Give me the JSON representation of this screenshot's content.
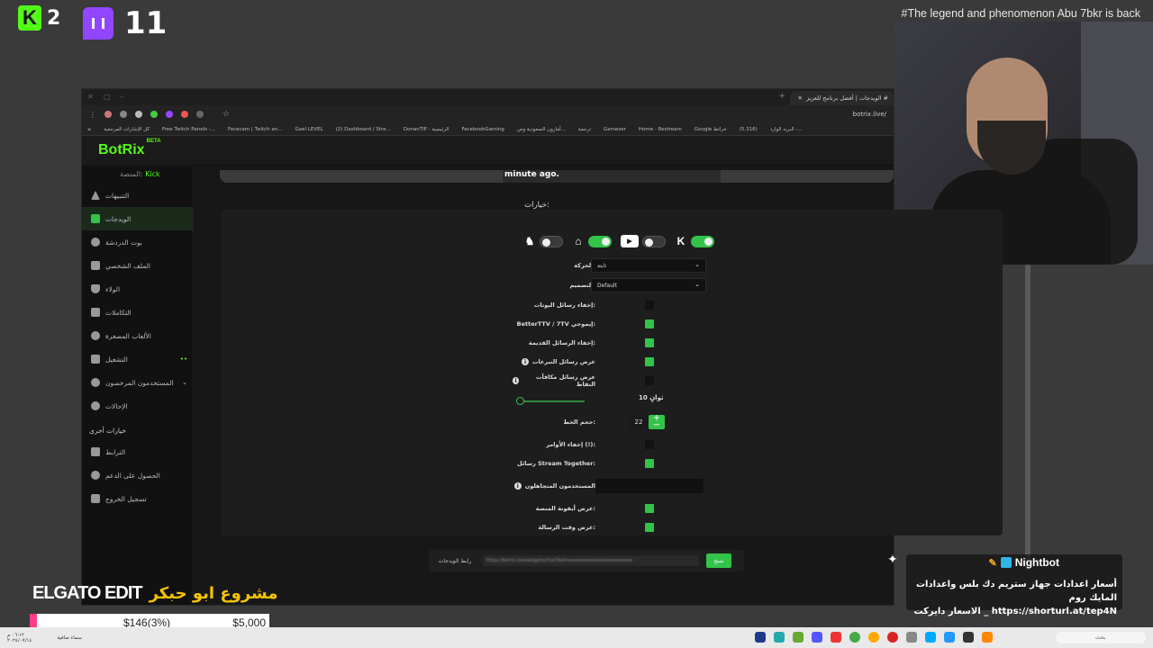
{
  "overlay": {
    "kick_count": "2",
    "twitch_count": "11",
    "kick_icon": "K",
    "marquee": "#The legend and phenomenon Abu 7bkr is back"
  },
  "browser": {
    "tab_title": "الويدجات | أفضل برنامج للعزيز #",
    "url": "botrix.live/",
    "bookmarks": [
      "كل الإشارات المرجعية",
      "Free Twitch Panels -...",
      "Facecam | Twitch an...",
      "Gael LEVEL",
      "(2) Dashboard / Stre...",
      "DonanTIP - الرئيسية",
      "FacebookGaming",
      "أمازون السعودية وص...",
      "ترجمة",
      "Gamezer",
      "Home - Restream",
      "Google خرائط",
      "(5,316)",
      "البريد الوارد -..."
    ]
  },
  "app": {
    "logo": "BotRix",
    "beta": "BETA",
    "platform_label": "المنصة:",
    "platform_value": "Kick",
    "nav": [
      {
        "label": "التنبيهات",
        "icon": "warning-icon"
      },
      {
        "label": "الويدجات",
        "icon": "widgets-icon"
      },
      {
        "label": "بوت الدردشة",
        "icon": "bot-icon"
      },
      {
        "label": "الملف الشخصي",
        "icon": "profile-icon"
      },
      {
        "label": "الولاء",
        "icon": "trophy-icon"
      },
      {
        "label": "التكاملات",
        "icon": "integrations-icon"
      },
      {
        "label": "الألعاب المصغرة",
        "icon": "gamepad-icon"
      },
      {
        "label": "التشغيل",
        "icon": "music-icon",
        "badge": "••"
      },
      {
        "label": "المستخدمون المرخصون",
        "icon": "users-icon",
        "chevron": "⌄"
      },
      {
        "label": "الإحالات",
        "icon": "referrals-icon"
      }
    ],
    "other_section": "خيارات أخرى",
    "other_nav": [
      {
        "label": "الترابط",
        "icon": "link-icon"
      },
      {
        "label": "الحصول على الدعم",
        "icon": "help-icon"
      },
      {
        "label": "تسجيل الخروج",
        "icon": "logout-icon"
      }
    ]
  },
  "content": {
    "toast_text": "minute ago.",
    "options_title": "خيارات:",
    "platform_toggles": [
      {
        "icon": "kick-icon",
        "glyph": "K",
        "on": true
      },
      {
        "icon": "youtube-icon",
        "glyph": "▶",
        "on": false
      },
      {
        "icon": "twitch-icon",
        "glyph": "⌂",
        "on": true
      },
      {
        "icon": "trovo-icon",
        "glyph": "♞",
        "on": false
      }
    ],
    "motion_label": "الحركة:",
    "motion_value": "ثابتة",
    "design_label": "التصميم:",
    "design_value": "Default",
    "options": [
      {
        "label": "إخفاء رسائل البوتات:",
        "checked": false
      },
      {
        "label": "BetterTTV / 7TV إيموجي:",
        "checked": true
      },
      {
        "label": "إخفاء الرسائل القديمة:",
        "checked": true
      },
      {
        "label": "عرض رسائل التبرعات",
        "checked": true,
        "info": true
      },
      {
        "label": "عرض رسائل مكافآت النقاط",
        "checked": false,
        "info": true
      }
    ],
    "duration_value": "10 ثوانٍ",
    "font_size_label": "حجم الخط:",
    "font_size_value": "22",
    "stepper_plus": "+",
    "stepper_minus": "−",
    "options2": [
      {
        "label": "إخفاء الأوامر (!):",
        "checked": false
      },
      {
        "label": "رسائل Stream Together:",
        "checked": true
      }
    ],
    "ignored_users_label": "المستخدمون المتجاهلون",
    "options3": [
      {
        "label": "عرض أيقونة المنصة:",
        "checked": true
      },
      {
        "label": "عرض وقت الرسالة:",
        "checked": true
      }
    ],
    "widget_link_label": "رابط الويدجات",
    "widget_url": "https://botrix.live/widgets/chat?bid=xxxxxxxxxxxxxxxxxxxxxxxx",
    "copy_label": "نسخ"
  },
  "bottom": {
    "elgato": "ELGATO EDIT",
    "project_title": "مشروع ابو حبكر",
    "donation_current": "$146(3%)",
    "donation_goal": "$5,000",
    "donation_progress": 0.03,
    "nightbot_name": "Nightbot",
    "nightbot_msg1": "أسعار اعدادات جهاز ستريم دك بلس واعدادات المايك روم",
    "nightbot_msg2": "الاسعار دايركت _ https://shorturl.at/tep4N"
  },
  "taskbar": {
    "clock": "٠٦:١٢ م",
    "date": "٢٠٢٤/٠٧/١٤",
    "weather": "سماء صافية",
    "search": "بحث"
  },
  "colors": {
    "accent": "#33c34a",
    "kick": "#53fc18",
    "twitch": "#9146ff"
  }
}
